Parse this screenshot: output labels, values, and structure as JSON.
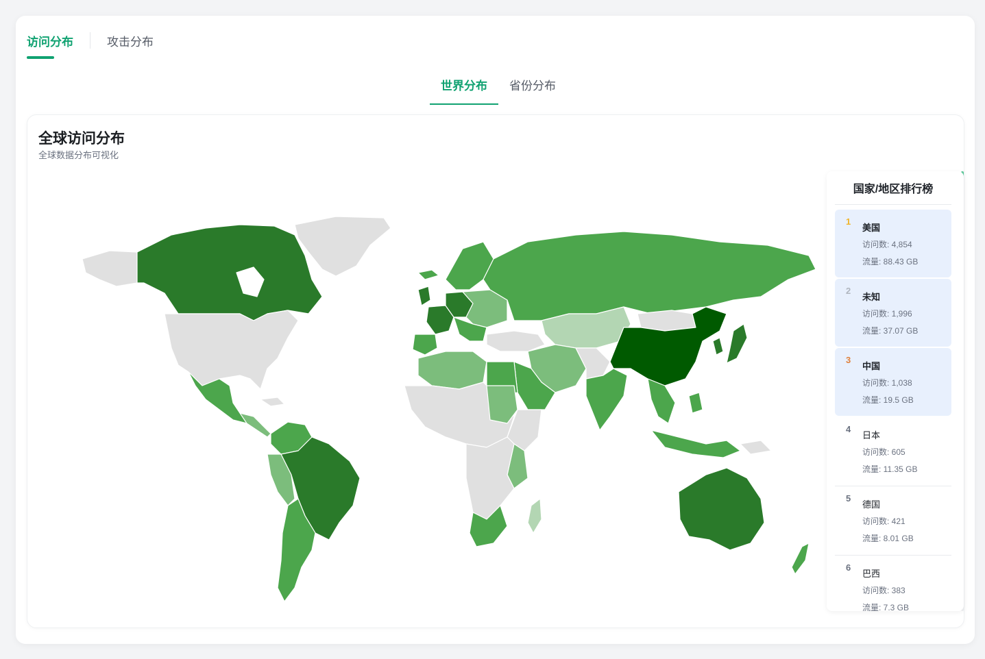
{
  "tabs": {
    "main": [
      "访问分布",
      "攻击分布"
    ],
    "sub": [
      "世界分布",
      "省份分布"
    ]
  },
  "card": {
    "title": "全球访问分布",
    "subtitle": "全球数据分布可视化"
  },
  "ranking": {
    "title": "国家/地区排行榜",
    "items": [
      {
        "rank": "1",
        "name": "美国",
        "visits": "访问数: 4,854",
        "traffic": "流量: 88.43 GB"
      },
      {
        "rank": "2",
        "name": "未知",
        "visits": "访问数: 1,996",
        "traffic": "流量: 37.07 GB"
      },
      {
        "rank": "3",
        "name": "中国",
        "visits": "访问数: 1,038",
        "traffic": "流量: 19.5 GB"
      },
      {
        "rank": "4",
        "name": "日本",
        "visits": "访问数: 605",
        "traffic": "流量: 11.35 GB"
      },
      {
        "rank": "5",
        "name": "德国",
        "visits": "访问数: 421",
        "traffic": "流量: 8.01 GB"
      },
      {
        "rank": "6",
        "name": "巴西",
        "visits": "访问数: 383",
        "traffic": "流量: 7.3 GB"
      }
    ]
  },
  "colors": {
    "accent": "#10a271",
    "gold": "#f0b429",
    "silver": "#b0b6bf",
    "bronze": "#e0823d",
    "map_darkest": "#005a00",
    "map_dark": "#2a7a2a",
    "map_mid": "#4ca64c",
    "map_light": "#7cbd7c",
    "map_lighter": "#b3d6b3",
    "map_empty": "#e0e0e0"
  }
}
